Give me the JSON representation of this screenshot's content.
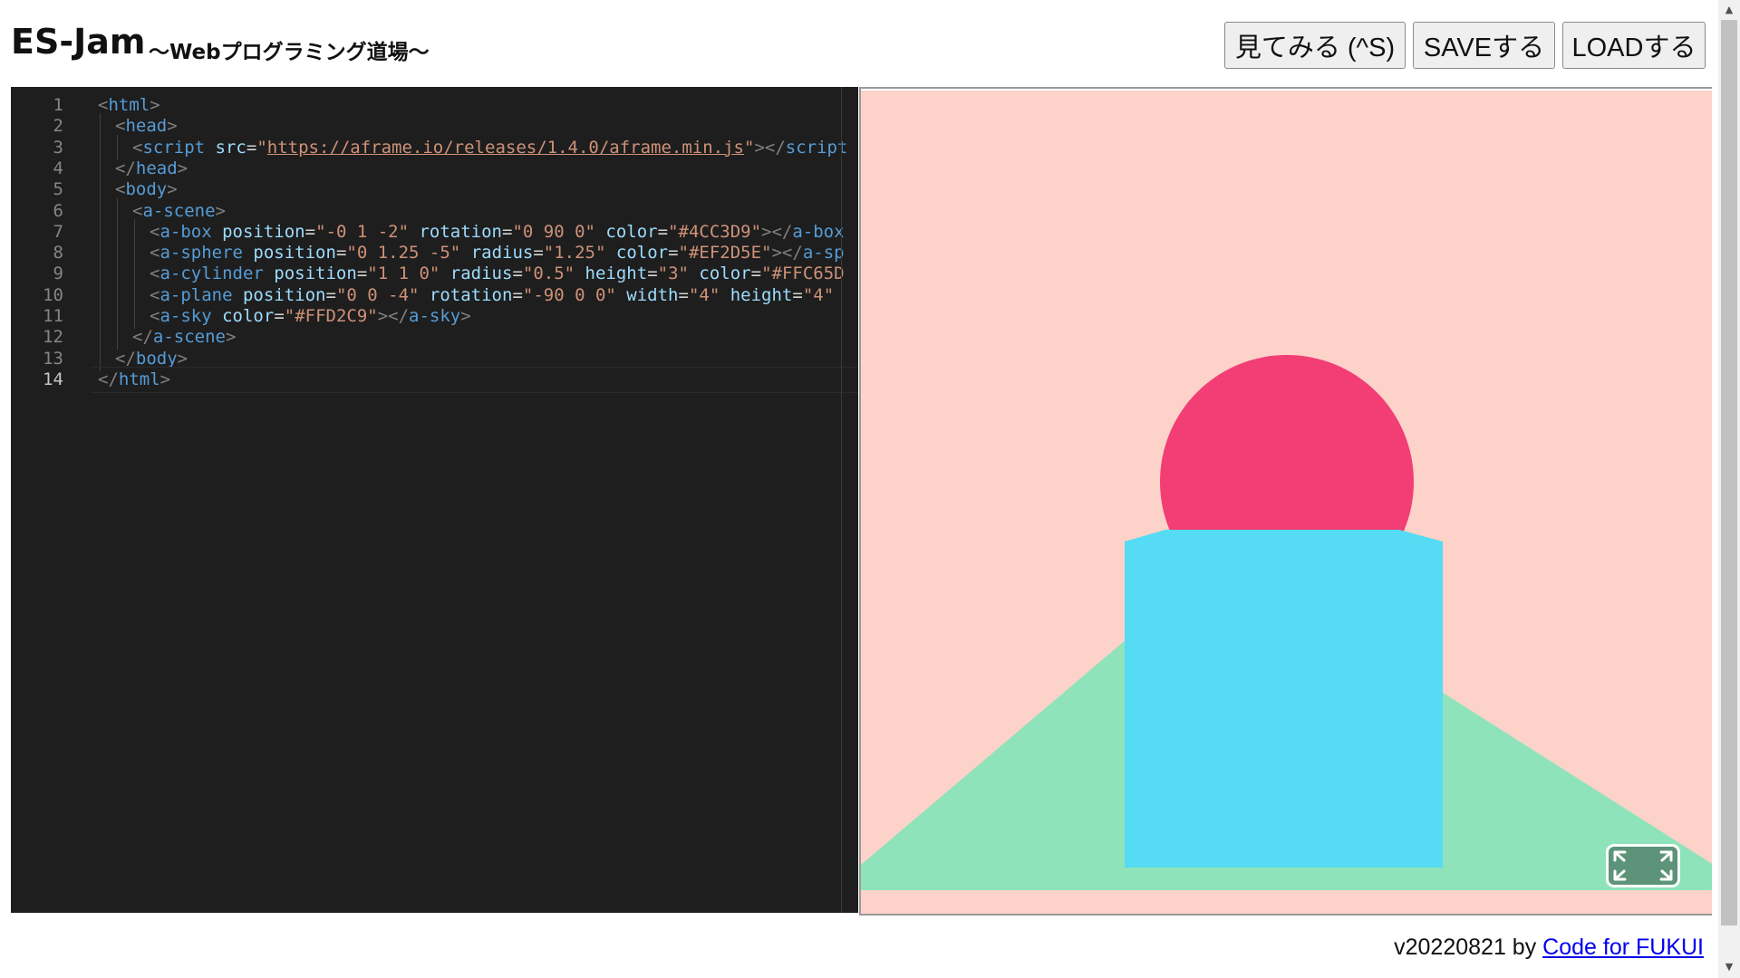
{
  "header": {
    "title": "ES-Jam",
    "subtitle": "～Webプログラミング道場～",
    "view_button": "見てみる (^S)",
    "save_button": "SAVEする",
    "load_button": "LOADする"
  },
  "editor": {
    "active_line": 14,
    "lines": [
      {
        "n": "1",
        "indent": 0,
        "parts": [
          [
            "br",
            "<"
          ],
          [
            "tag",
            "html"
          ],
          [
            "br",
            ">"
          ]
        ]
      },
      {
        "n": "2",
        "indent": 1,
        "parts": [
          [
            "br",
            "<"
          ],
          [
            "tag",
            "head"
          ],
          [
            "br",
            ">"
          ]
        ]
      },
      {
        "n": "3",
        "indent": 2,
        "parts": [
          [
            "br",
            "<"
          ],
          [
            "tag",
            "script"
          ],
          [
            "sp",
            " "
          ],
          [
            "attr",
            "src"
          ],
          [
            "eq",
            "="
          ],
          [
            "str",
            "\""
          ],
          [
            "url",
            "https://aframe.io/releases/1.4.0/aframe.min.js"
          ],
          [
            "str",
            "\""
          ],
          [
            "br",
            "></"
          ],
          [
            "tag",
            "script"
          ]
        ]
      },
      {
        "n": "4",
        "indent": 1,
        "parts": [
          [
            "br",
            "</"
          ],
          [
            "tag",
            "head"
          ],
          [
            "br",
            ">"
          ]
        ]
      },
      {
        "n": "5",
        "indent": 1,
        "parts": [
          [
            "br",
            "<"
          ],
          [
            "tag",
            "body"
          ],
          [
            "br",
            ">"
          ]
        ]
      },
      {
        "n": "6",
        "indent": 2,
        "parts": [
          [
            "br",
            "<"
          ],
          [
            "tag",
            "a-scene"
          ],
          [
            "br",
            ">"
          ]
        ]
      },
      {
        "n": "7",
        "indent": 3,
        "parts": [
          [
            "br",
            "<"
          ],
          [
            "tag",
            "a-box"
          ],
          [
            "sp",
            " "
          ],
          [
            "attr",
            "position"
          ],
          [
            "eq",
            "="
          ],
          [
            "str",
            "\"-0 1 -2\""
          ],
          [
            "sp",
            " "
          ],
          [
            "attr",
            "rotation"
          ],
          [
            "eq",
            "="
          ],
          [
            "str",
            "\"0 90 0\""
          ],
          [
            "sp",
            " "
          ],
          [
            "attr",
            "color"
          ],
          [
            "eq",
            "="
          ],
          [
            "str",
            "\"#4CC3D9\""
          ],
          [
            "br",
            "></"
          ],
          [
            "tag",
            "a-box"
          ]
        ]
      },
      {
        "n": "8",
        "indent": 3,
        "parts": [
          [
            "br",
            "<"
          ],
          [
            "tag",
            "a-sphere"
          ],
          [
            "sp",
            " "
          ],
          [
            "attr",
            "position"
          ],
          [
            "eq",
            "="
          ],
          [
            "str",
            "\"0 1.25 -5\""
          ],
          [
            "sp",
            " "
          ],
          [
            "attr",
            "radius"
          ],
          [
            "eq",
            "="
          ],
          [
            "str",
            "\"1.25\""
          ],
          [
            "sp",
            " "
          ],
          [
            "attr",
            "color"
          ],
          [
            "eq",
            "="
          ],
          [
            "str",
            "\"#EF2D5E\""
          ],
          [
            "br",
            "></"
          ],
          [
            "tag",
            "a-sp"
          ]
        ]
      },
      {
        "n": "9",
        "indent": 3,
        "parts": [
          [
            "br",
            "<"
          ],
          [
            "tag",
            "a-cylinder"
          ],
          [
            "sp",
            " "
          ],
          [
            "attr",
            "position"
          ],
          [
            "eq",
            "="
          ],
          [
            "str",
            "\"1 1 0\""
          ],
          [
            "sp",
            " "
          ],
          [
            "attr",
            "radius"
          ],
          [
            "eq",
            "="
          ],
          [
            "str",
            "\"0.5\""
          ],
          [
            "sp",
            " "
          ],
          [
            "attr",
            "height"
          ],
          [
            "eq",
            "="
          ],
          [
            "str",
            "\"3\""
          ],
          [
            "sp",
            " "
          ],
          [
            "attr",
            "color"
          ],
          [
            "eq",
            "="
          ],
          [
            "str",
            "\"#FFC65D"
          ]
        ]
      },
      {
        "n": "10",
        "indent": 3,
        "parts": [
          [
            "br",
            "<"
          ],
          [
            "tag",
            "a-plane"
          ],
          [
            "sp",
            " "
          ],
          [
            "attr",
            "position"
          ],
          [
            "eq",
            "="
          ],
          [
            "str",
            "\"0 0 -4\""
          ],
          [
            "sp",
            " "
          ],
          [
            "attr",
            "rotation"
          ],
          [
            "eq",
            "="
          ],
          [
            "str",
            "\"-90 0 0\""
          ],
          [
            "sp",
            " "
          ],
          [
            "attr",
            "width"
          ],
          [
            "eq",
            "="
          ],
          [
            "str",
            "\"4\""
          ],
          [
            "sp",
            " "
          ],
          [
            "attr",
            "height"
          ],
          [
            "eq",
            "="
          ],
          [
            "str",
            "\"4\""
          ]
        ]
      },
      {
        "n": "11",
        "indent": 3,
        "parts": [
          [
            "br",
            "<"
          ],
          [
            "tag",
            "a-sky"
          ],
          [
            "sp",
            " "
          ],
          [
            "attr",
            "color"
          ],
          [
            "eq",
            "="
          ],
          [
            "str",
            "\"#FFD2C9\""
          ],
          [
            "br",
            "></"
          ],
          [
            "tag",
            "a-sky"
          ],
          [
            "br",
            ">"
          ]
        ]
      },
      {
        "n": "12",
        "indent": 2,
        "parts": [
          [
            "br",
            "</"
          ],
          [
            "tag",
            "a-scene"
          ],
          [
            "br",
            ">"
          ]
        ]
      },
      {
        "n": "13",
        "indent": 1,
        "parts": [
          [
            "br",
            "</"
          ],
          [
            "tag",
            "body"
          ],
          [
            "br",
            ">"
          ]
        ]
      },
      {
        "n": "14",
        "indent": 0,
        "parts": [
          [
            "br",
            "</"
          ],
          [
            "tag",
            "html"
          ],
          [
            "br",
            ">"
          ]
        ]
      }
    ]
  },
  "preview": {
    "sky_color": "#FCD2C9",
    "plane_color": "#8FE3BA",
    "box_color": "#55DBF3",
    "sphere_color": "#F23D75",
    "fullscreen_icon": "expand-icon"
  },
  "footer": {
    "version_text": "v20220821 by ",
    "link_text": "Code for FUKUI"
  }
}
